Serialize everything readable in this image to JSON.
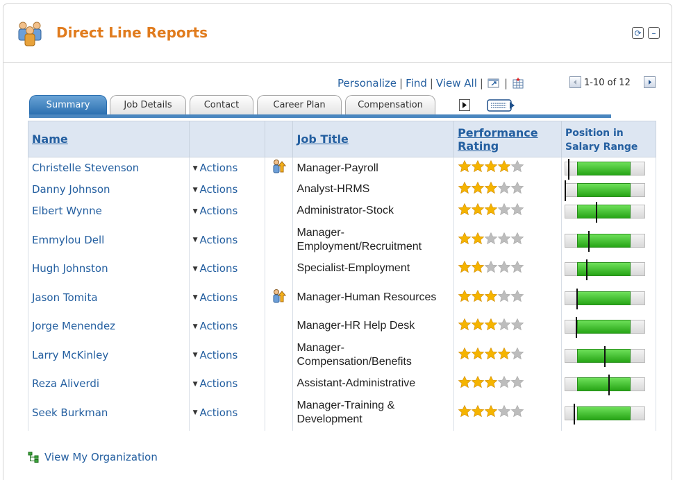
{
  "pagelet": {
    "title": "Direct Line Reports",
    "refresh_icon": "refresh-icon",
    "minimize_icon": "minimize-icon"
  },
  "toolbar": {
    "personalize": "Personalize",
    "find": "Find",
    "view_all": "View All",
    "separator": "|",
    "pager": "1-10 of 12"
  },
  "tabs": [
    {
      "label": "Summary",
      "active": true
    },
    {
      "label": "Job Details",
      "active": false
    },
    {
      "label": "Contact",
      "active": false
    },
    {
      "label": "Career Plan",
      "active": false
    },
    {
      "label": "Compensation",
      "active": false
    }
  ],
  "columns": {
    "name": "Name",
    "job_title": "Job Title",
    "performance_rating": "Performance Rating",
    "position_in_salary_range": "Position in Salary Range"
  },
  "rows": [
    {
      "name": "Christelle Stevenson",
      "actions": "Actions",
      "manager_icon": true,
      "job_title": "Manager-Payroll",
      "rating": 4,
      "salary_position": 0.04
    },
    {
      "name": "Danny Johnson",
      "actions": "Actions",
      "manager_icon": false,
      "job_title": "Analyst-HRMS",
      "rating": 3,
      "salary_position": 0.0
    },
    {
      "name": "Elbert Wynne",
      "actions": "Actions",
      "manager_icon": false,
      "job_title": "Administrator-Stock",
      "rating": 3,
      "salary_position": 0.39
    },
    {
      "name": "Emmylou Dell",
      "actions": "Actions",
      "manager_icon": false,
      "job_title": "Manager-Employment/Recruitment",
      "rating": 2,
      "salary_position": 0.29
    },
    {
      "name": "Hugh Johnston",
      "actions": "Actions",
      "manager_icon": false,
      "job_title": "Specialist-Employment",
      "rating": 2,
      "salary_position": 0.27
    },
    {
      "name": "Jason Tomita",
      "actions": "Actions",
      "manager_icon": true,
      "job_title": "Manager-Human Resources",
      "rating": 3,
      "salary_position": 0.15
    },
    {
      "name": "Jorge Menendez",
      "actions": "Actions",
      "manager_icon": false,
      "job_title": "Manager-HR Help Desk",
      "rating": 3,
      "salary_position": 0.14
    },
    {
      "name": "Larry McKinley",
      "actions": "Actions",
      "manager_icon": false,
      "job_title": "Manager-Compensation/Benefits",
      "rating": 4,
      "salary_position": 0.49
    },
    {
      "name": "Reza Aliverdi",
      "actions": "Actions",
      "manager_icon": false,
      "job_title": "Assistant-Administrative",
      "rating": 3,
      "salary_position": 0.54
    },
    {
      "name": "Seek Burkman",
      "actions": "Actions",
      "manager_icon": false,
      "job_title": "Manager-Training & Development",
      "rating": 3,
      "salary_position": 0.11
    }
  ],
  "footer": {
    "org_link": "View My Organization"
  },
  "colors": {
    "title": "#e07b1d",
    "link": "#245fa0",
    "star_filled": "#f5b400",
    "star_empty": "#bdbdbd",
    "salary_bar": "#3cc22b"
  }
}
